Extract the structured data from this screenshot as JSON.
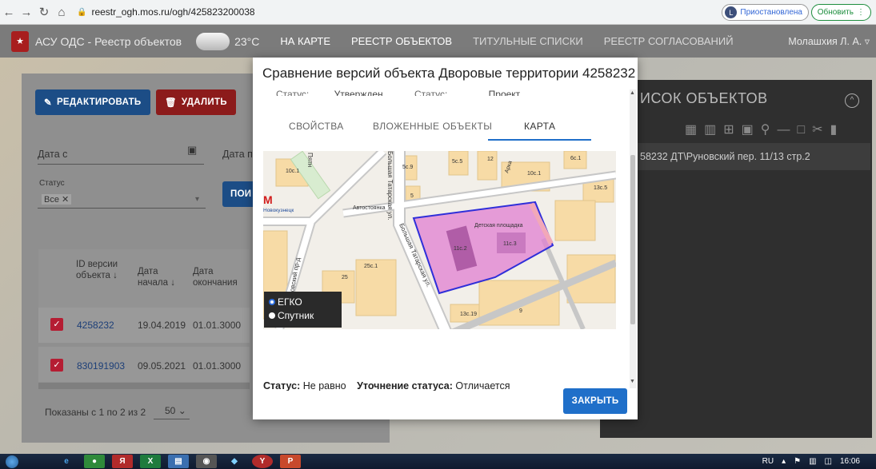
{
  "browser": {
    "url": "reestr_ogh.mos.ru/ogh/425823200038",
    "profile_initial": "L",
    "profile_status": "Приостановлена",
    "update_label": "Обновить"
  },
  "header": {
    "app_title": "АСУ ОДС - Реестр объектов",
    "temperature": "23°C",
    "menu": [
      "НА КАРТЕ",
      "РЕЕСТР ОБЪЕКТОВ",
      "ТИТУЛЬНЫЕ СПИСКИ",
      "РЕЕСТР СОГЛАСОВАНИЙ"
    ],
    "user": "Молашхия Л. А."
  },
  "background": {
    "edit_label": "РЕДАКТИРОВАТЬ",
    "delete_label": "УДАЛИТЬ",
    "date_from_label": "Дата с",
    "date_to_label": "Дата п",
    "status_label": "Статус",
    "status_value": "Все",
    "search_label": "ПОИ",
    "columns": [
      "ID версии объекта",
      "Дата начала",
      "Дата окончания"
    ],
    "rows": [
      {
        "id": "4258232",
        "start": "19.04.2019",
        "end": "01.01.3000"
      },
      {
        "id": "830191903",
        "start": "09.05.2021",
        "end": "01.01.3000"
      }
    ],
    "pagination_text": "Показаны с 1 по 2 из 2",
    "page_size": "50"
  },
  "right_panel": {
    "title": "ИСОК ОБЪЕКТОВ",
    "item": "58232 ДТ\\Руновский пер. 11/13 стр.2"
  },
  "modal": {
    "title": "Сравнение версий объекта Дворовые территории 4258232",
    "status_label_1": "Статус:",
    "status_value_1": "Утвержден",
    "status_label_2": "Статус:",
    "status_value_2": "Проект",
    "tabs": [
      "СВОЙСТВА",
      "ВЛОЖЕННЫЕ ОБЪЕКТЫ",
      "КАРТА"
    ],
    "active_tab": "КАРТА",
    "footer_status_label": "Статус:",
    "footer_status_value": "Не равно",
    "footer_refine_label": "Уточнение статуса:",
    "footer_refine_value": "Отличается",
    "close_label": "ЗАКРЫТЬ"
  },
  "map": {
    "layers": [
      "ЕГКО",
      "Спутник"
    ],
    "selected_layer": "ЕГКО",
    "labels": {
      "playground": "Детская площадка",
      "parking": "Автостоянка",
      "street_main": "Большая Татарская ул.",
      "street_top": "Большая Татарская ул.",
      "street_left": "Руновский пр-д",
      "street_pyat": "Пятн",
      "street_arka": "Арка",
      "metro": "Новокузнецк",
      "b1": "10с.1",
      "b2": "5с.9",
      "b3": "5с.5",
      "b4": "12",
      "b5": "10с.1",
      "b6": "6с.1",
      "b7": "13с.5",
      "b8": "5",
      "b9": "11с.2",
      "b10": "11с.3",
      "b11": "25с.1",
      "b12": "25",
      "b13": "9",
      "b14": "13с.19"
    }
  },
  "taskbar": {
    "lang": "RU",
    "time": "16:06"
  },
  "colors": {
    "primary": "#1f6fc9",
    "delete_red": "#8c1b1b",
    "polygon_fill": "#e07fd0",
    "polygon_outline": "#2f2fd9"
  }
}
